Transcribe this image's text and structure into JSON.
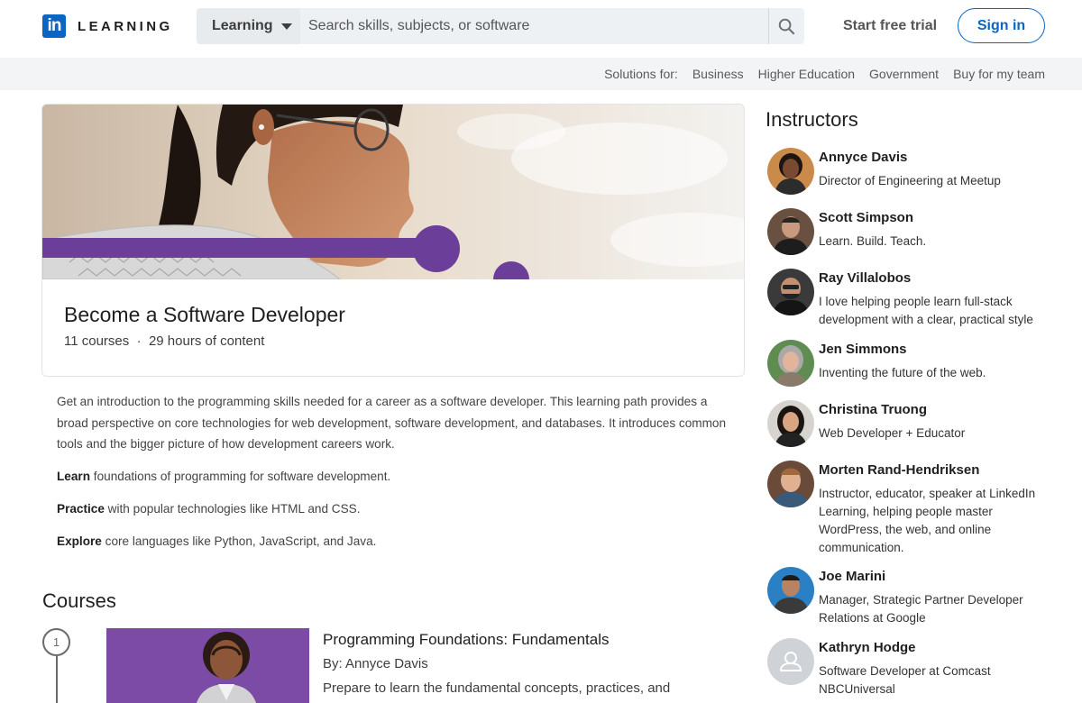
{
  "header": {
    "logo_mark": "in",
    "logo_text": "LEARNING",
    "search_dropdown": "Learning",
    "search_placeholder": "Search skills, subjects, or software",
    "free_trial": "Start free trial",
    "sign_in": "Sign in"
  },
  "solutions": {
    "label": "Solutions for:",
    "items": [
      "Business",
      "Higher Education",
      "Government",
      "Buy for my team"
    ]
  },
  "path": {
    "title": "Become a Software Developer",
    "courses": "11 courses",
    "separator": "·",
    "hours": "29 hours of content",
    "description": "Get an introduction to the programming skills needed for a career as a software developer. This learning path provides a broad perspective on core technologies for web development, software development, and databases. It introduces common tools and the bigger picture of how development careers work.",
    "bullets": [
      {
        "bold": "Learn",
        "text": " foundations of programming for software development."
      },
      {
        "bold": "Practice",
        "text": " with popular technologies like HTML and CSS."
      },
      {
        "bold": "Explore",
        "text": " core languages like Python, JavaScript, and Java."
      }
    ]
  },
  "courses": {
    "heading": "Courses",
    "items": [
      {
        "step": "1",
        "title": "Programming Foundations: Fundamentals",
        "by": "By: Annyce Davis",
        "desc": "Prepare to learn the fundamental concepts, practices, and"
      }
    ]
  },
  "instructors": {
    "heading": "Instructors",
    "items": [
      {
        "name": "Annyce Davis",
        "title": "Director of Engineering at Meetup"
      },
      {
        "name": "Scott Simpson",
        "title": "Learn. Build. Teach."
      },
      {
        "name": "Ray Villalobos",
        "title": "I love helping people learn full-stack development with a clear, practical style"
      },
      {
        "name": "Jen Simmons",
        "title": "Inventing the future of the web."
      },
      {
        "name": "Christina Truong",
        "title": "Web Developer + Educator"
      },
      {
        "name": "Morten Rand-Hendriksen",
        "title": "Instructor, educator, speaker at LinkedIn Learning, helping people master WordPress, the web, and online communication."
      },
      {
        "name": "Joe Marini",
        "title": "Manager, Strategic Partner Developer Relations at Google"
      },
      {
        "name": "Kathryn Hodge",
        "title": "Software Developer at Comcast NBCUniversal"
      }
    ]
  },
  "colors": {
    "brand": "#0a66c2",
    "accent_purple": "#6b3e99"
  }
}
